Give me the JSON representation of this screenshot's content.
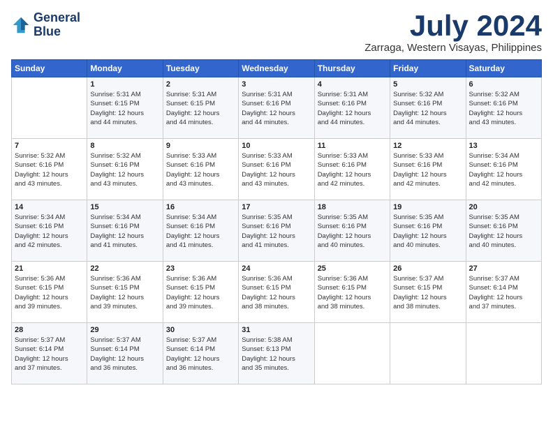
{
  "header": {
    "logo_line1": "General",
    "logo_line2": "Blue",
    "month": "July 2024",
    "location": "Zarraga, Western Visayas, Philippines"
  },
  "weekdays": [
    "Sunday",
    "Monday",
    "Tuesday",
    "Wednesday",
    "Thursday",
    "Friday",
    "Saturday"
  ],
  "weeks": [
    [
      {
        "day": "",
        "info": ""
      },
      {
        "day": "1",
        "info": "Sunrise: 5:31 AM\nSunset: 6:15 PM\nDaylight: 12 hours\nand 44 minutes."
      },
      {
        "day": "2",
        "info": "Sunrise: 5:31 AM\nSunset: 6:15 PM\nDaylight: 12 hours\nand 44 minutes."
      },
      {
        "day": "3",
        "info": "Sunrise: 5:31 AM\nSunset: 6:16 PM\nDaylight: 12 hours\nand 44 minutes."
      },
      {
        "day": "4",
        "info": "Sunrise: 5:31 AM\nSunset: 6:16 PM\nDaylight: 12 hours\nand 44 minutes."
      },
      {
        "day": "5",
        "info": "Sunrise: 5:32 AM\nSunset: 6:16 PM\nDaylight: 12 hours\nand 44 minutes."
      },
      {
        "day": "6",
        "info": "Sunrise: 5:32 AM\nSunset: 6:16 PM\nDaylight: 12 hours\nand 43 minutes."
      }
    ],
    [
      {
        "day": "7",
        "info": "Sunrise: 5:32 AM\nSunset: 6:16 PM\nDaylight: 12 hours\nand 43 minutes."
      },
      {
        "day": "8",
        "info": "Sunrise: 5:32 AM\nSunset: 6:16 PM\nDaylight: 12 hours\nand 43 minutes."
      },
      {
        "day": "9",
        "info": "Sunrise: 5:33 AM\nSunset: 6:16 PM\nDaylight: 12 hours\nand 43 minutes."
      },
      {
        "day": "10",
        "info": "Sunrise: 5:33 AM\nSunset: 6:16 PM\nDaylight: 12 hours\nand 43 minutes."
      },
      {
        "day": "11",
        "info": "Sunrise: 5:33 AM\nSunset: 6:16 PM\nDaylight: 12 hours\nand 42 minutes."
      },
      {
        "day": "12",
        "info": "Sunrise: 5:33 AM\nSunset: 6:16 PM\nDaylight: 12 hours\nand 42 minutes."
      },
      {
        "day": "13",
        "info": "Sunrise: 5:34 AM\nSunset: 6:16 PM\nDaylight: 12 hours\nand 42 minutes."
      }
    ],
    [
      {
        "day": "14",
        "info": "Sunrise: 5:34 AM\nSunset: 6:16 PM\nDaylight: 12 hours\nand 42 minutes."
      },
      {
        "day": "15",
        "info": "Sunrise: 5:34 AM\nSunset: 6:16 PM\nDaylight: 12 hours\nand 41 minutes."
      },
      {
        "day": "16",
        "info": "Sunrise: 5:34 AM\nSunset: 6:16 PM\nDaylight: 12 hours\nand 41 minutes."
      },
      {
        "day": "17",
        "info": "Sunrise: 5:35 AM\nSunset: 6:16 PM\nDaylight: 12 hours\nand 41 minutes."
      },
      {
        "day": "18",
        "info": "Sunrise: 5:35 AM\nSunset: 6:16 PM\nDaylight: 12 hours\nand 40 minutes."
      },
      {
        "day": "19",
        "info": "Sunrise: 5:35 AM\nSunset: 6:16 PM\nDaylight: 12 hours\nand 40 minutes."
      },
      {
        "day": "20",
        "info": "Sunrise: 5:35 AM\nSunset: 6:16 PM\nDaylight: 12 hours\nand 40 minutes."
      }
    ],
    [
      {
        "day": "21",
        "info": "Sunrise: 5:36 AM\nSunset: 6:15 PM\nDaylight: 12 hours\nand 39 minutes."
      },
      {
        "day": "22",
        "info": "Sunrise: 5:36 AM\nSunset: 6:15 PM\nDaylight: 12 hours\nand 39 minutes."
      },
      {
        "day": "23",
        "info": "Sunrise: 5:36 AM\nSunset: 6:15 PM\nDaylight: 12 hours\nand 39 minutes."
      },
      {
        "day": "24",
        "info": "Sunrise: 5:36 AM\nSunset: 6:15 PM\nDaylight: 12 hours\nand 38 minutes."
      },
      {
        "day": "25",
        "info": "Sunrise: 5:36 AM\nSunset: 6:15 PM\nDaylight: 12 hours\nand 38 minutes."
      },
      {
        "day": "26",
        "info": "Sunrise: 5:37 AM\nSunset: 6:15 PM\nDaylight: 12 hours\nand 38 minutes."
      },
      {
        "day": "27",
        "info": "Sunrise: 5:37 AM\nSunset: 6:14 PM\nDaylight: 12 hours\nand 37 minutes."
      }
    ],
    [
      {
        "day": "28",
        "info": "Sunrise: 5:37 AM\nSunset: 6:14 PM\nDaylight: 12 hours\nand 37 minutes."
      },
      {
        "day": "29",
        "info": "Sunrise: 5:37 AM\nSunset: 6:14 PM\nDaylight: 12 hours\nand 36 minutes."
      },
      {
        "day": "30",
        "info": "Sunrise: 5:37 AM\nSunset: 6:14 PM\nDaylight: 12 hours\nand 36 minutes."
      },
      {
        "day": "31",
        "info": "Sunrise: 5:38 AM\nSunset: 6:13 PM\nDaylight: 12 hours\nand 35 minutes."
      },
      {
        "day": "",
        "info": ""
      },
      {
        "day": "",
        "info": ""
      },
      {
        "day": "",
        "info": ""
      }
    ]
  ]
}
